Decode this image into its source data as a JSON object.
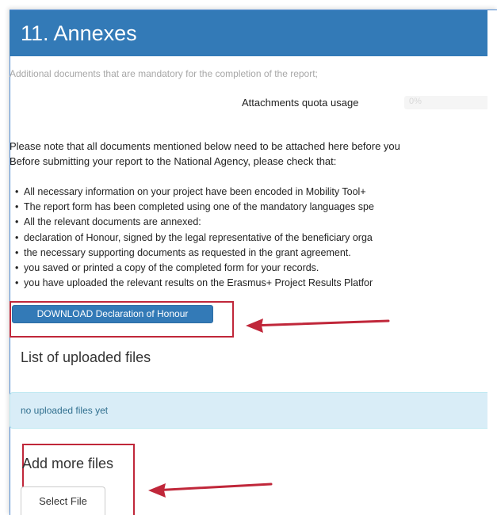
{
  "section": {
    "title": "11. Annexes",
    "subtitle": "Additional documents that are mandatory for the completion of the report;"
  },
  "quota": {
    "label": "Attachments quota usage",
    "value_text": "0%",
    "percent": 0
  },
  "notes": {
    "line1": "Please note that all documents mentioned below need to be attached here before you",
    "line2": "Before submitting your report to the National Agency, please check that:"
  },
  "checklist": [
    "All necessary information on your project have been encoded in Mobility Tool+",
    "The report form has been completed using one of the mandatory languages spe",
    "All the relevant documents are annexed:",
    "declaration of Honour, signed by the legal representative of the beneficiary orga",
    "the necessary supporting documents as requested in the grant agreement.",
    "you saved or printed a copy of the completed form for your records.",
    "you have uploaded the relevant results on the Erasmus+ Project Results Platfor"
  ],
  "download_button": {
    "label": "DOWNLOAD Declaration of Honour"
  },
  "uploaded_files": {
    "title": "List of uploaded files",
    "empty_message": "no uploaded files yet"
  },
  "add_files": {
    "title": "Add more files",
    "select_label": "Select File"
  },
  "colors": {
    "header_bg": "#337ab7",
    "highlight": "#c0273a",
    "info_bg": "#d9edf7",
    "info_text": "#31708f"
  }
}
